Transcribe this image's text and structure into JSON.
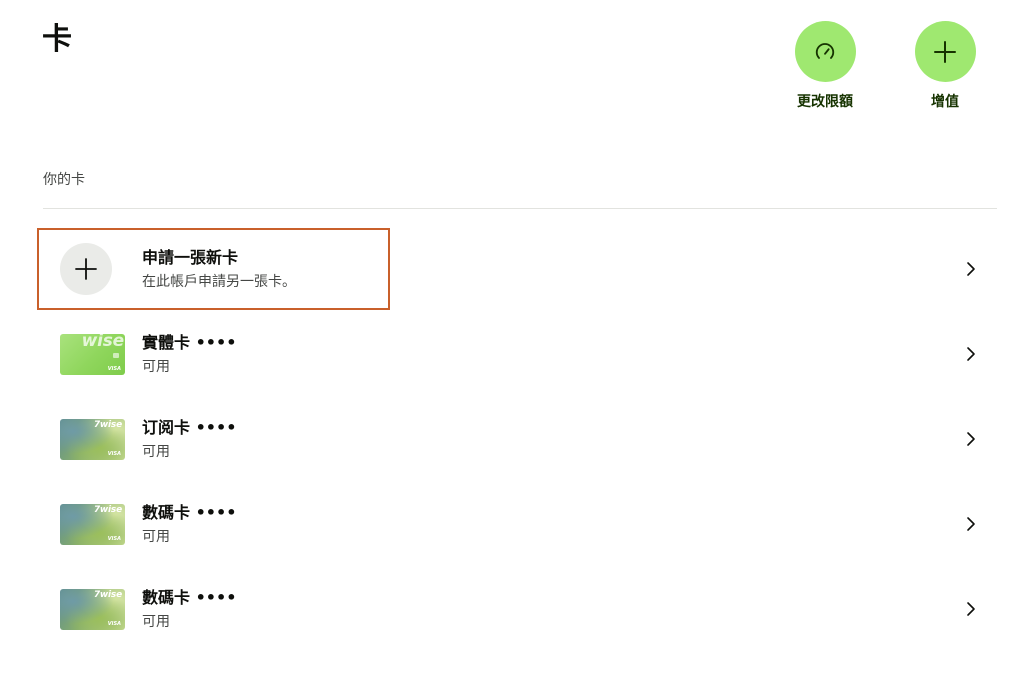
{
  "page": {
    "title": "卡"
  },
  "actions": {
    "limit_label": "更改限額",
    "topup_label": "增值"
  },
  "section": {
    "label": "你的卡"
  },
  "new_card": {
    "title": "申請一張新卡",
    "subtitle": "在此帳戶申請另一張卡。"
  },
  "cards": [
    {
      "name": "實體卡 ••••",
      "status": "可用",
      "style": "green",
      "brand": "wise",
      "network": "VISA"
    },
    {
      "name": "订阅卡 ••••",
      "status": "可用",
      "style": "art",
      "brand": "7wise",
      "network": "VISA"
    },
    {
      "name": "數碼卡 ••••",
      "status": "可用",
      "style": "art",
      "brand": "7wise",
      "network": "VISA"
    },
    {
      "name": "數碼卡 ••••",
      "status": "可用",
      "style": "art",
      "brand": "7wise",
      "network": "VISA"
    }
  ],
  "colors": {
    "accent": "#9fe870",
    "accent_text": "#163300",
    "highlight_border": "#c9602b"
  },
  "icons": {
    "limit": "speedometer-icon",
    "topup": "plus-icon",
    "new_card": "plus-icon",
    "row_arrow": "chevron-right-icon"
  }
}
